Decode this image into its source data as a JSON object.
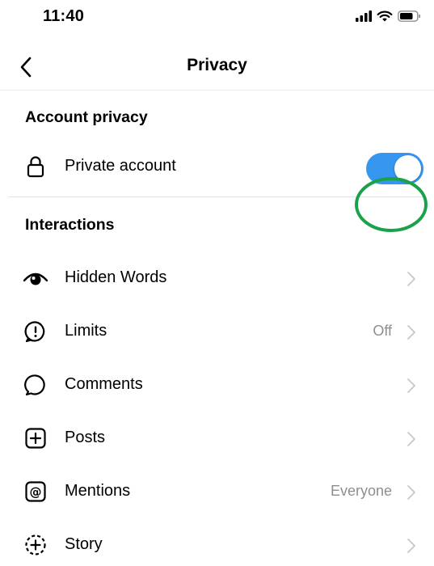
{
  "status_bar": {
    "time": "11:40"
  },
  "nav": {
    "title": "Privacy"
  },
  "sections": {
    "account_privacy": {
      "title": "Account privacy",
      "private_account": {
        "label": "Private account",
        "toggle_on": true,
        "toggle_color": "#3797f0"
      }
    },
    "interactions": {
      "title": "Interactions",
      "items": [
        {
          "label": "Hidden Words",
          "value": "",
          "icon": "eye-icon"
        },
        {
          "label": "Limits",
          "value": "Off",
          "icon": "limits-icon"
        },
        {
          "label": "Comments",
          "value": "",
          "icon": "comment-bubble-icon"
        },
        {
          "label": "Posts",
          "value": "",
          "icon": "add-post-icon"
        },
        {
          "label": "Mentions",
          "value": "Everyone",
          "icon": "at-sign-icon"
        },
        {
          "label": "Story",
          "value": "",
          "icon": "add-story-icon"
        }
      ]
    }
  },
  "annotation": {
    "color": "#1aa24a",
    "shape": "ellipse"
  }
}
